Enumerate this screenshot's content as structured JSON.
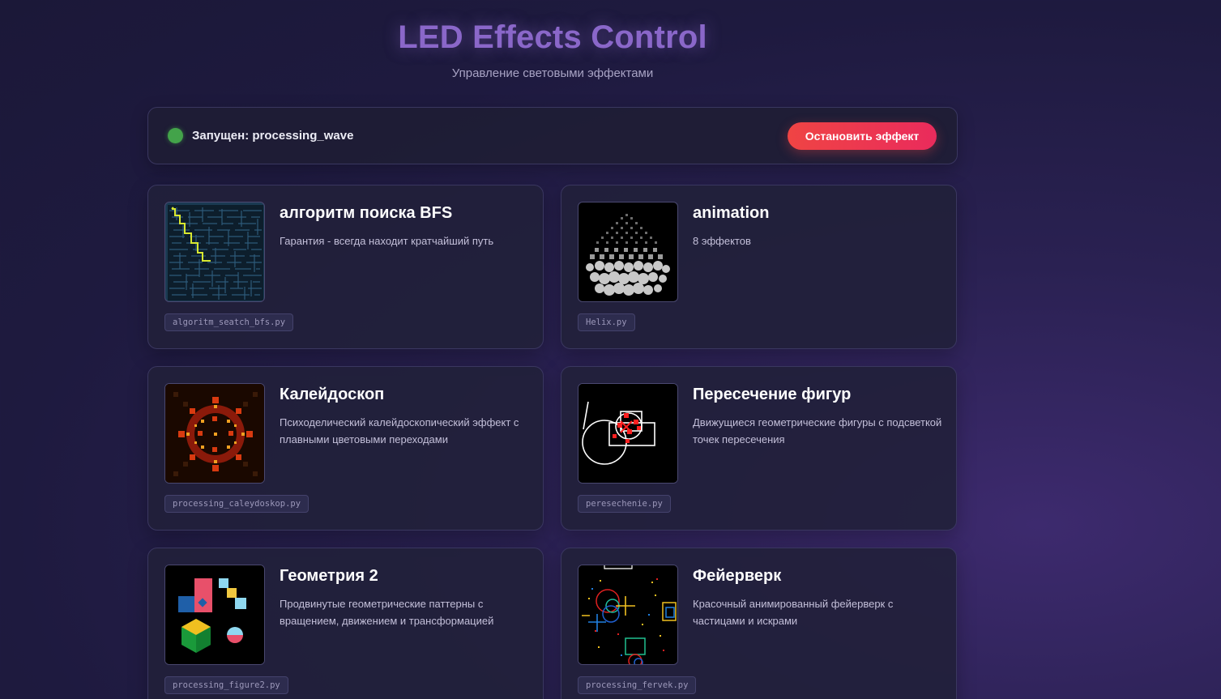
{
  "header": {
    "title": "LED Effects Control",
    "subtitle": "Управление световыми эффектами"
  },
  "status": {
    "text": "Запущен: processing_wave",
    "indicator_color": "#43a34a",
    "stop_button_label": "Остановить эффект"
  },
  "effects": [
    {
      "title": "алгоритм поиска BFS",
      "description": "Гарантия - всегда находит кратчайший путь",
      "file": "algoritm_seatch_bfs.py",
      "preview_icon": "maze-preview"
    },
    {
      "title": "animation",
      "description": "8 эффектов",
      "file": "Helix.py",
      "preview_icon": "dot-cube-preview"
    },
    {
      "title": "Калейдоскоп",
      "description": "Психоделический калейдоскопический эффект с плавными цветовыми переходами",
      "file": "processing_caleydoskop.py",
      "preview_icon": "kaleidoscope-preview"
    },
    {
      "title": "Пересечение фигур",
      "description": "Движущиеся геометрические фигуры с подсветкой точек пересечения",
      "file": "peresechenie.py",
      "preview_icon": "shapes-intersection-preview"
    },
    {
      "title": "Геометрия 2",
      "description": "Продвинутые геометрические паттерны с вращением, движением и трансформацией",
      "file": "processing_figure2.py",
      "preview_icon": "geometry-preview"
    },
    {
      "title": "Фейерверк",
      "description": "Красочный анимированный фейерверк с частицами и искрами",
      "file": "processing_fervek.py",
      "preview_icon": "fireworks-preview"
    }
  ],
  "colors": {
    "accent": "#8a67c9",
    "stop_button": "#ef4444",
    "card_bg": "#21203a"
  }
}
